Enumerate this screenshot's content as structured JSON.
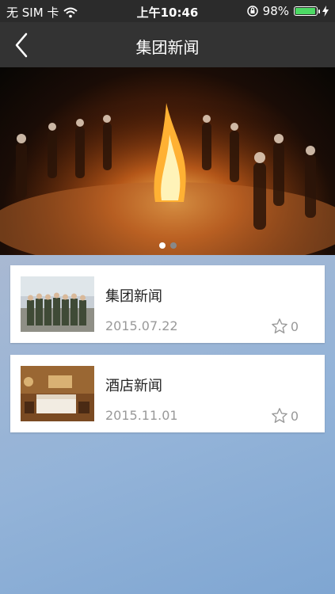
{
  "status": {
    "carrier": "无 SIM 卡",
    "time": "上午10:46",
    "battery": "98%"
  },
  "nav": {
    "title": "集团新闻"
  },
  "banner": {
    "slides": 2,
    "active_slide": 1
  },
  "news": [
    {
      "title": "集团新闻",
      "date": "2015.07.22",
      "count": "0"
    },
    {
      "title": "酒店新闻",
      "date": "2015.11.01",
      "count": "0"
    }
  ],
  "colors": {
    "navbar": "#333333",
    "battery": "#4cd964"
  }
}
